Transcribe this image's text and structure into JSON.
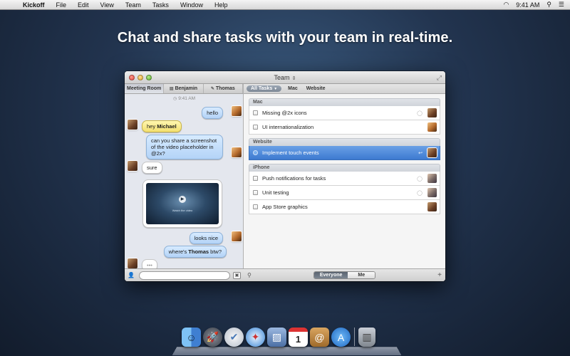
{
  "menubar": {
    "app_name": "Kickoff",
    "items": [
      "File",
      "Edit",
      "View",
      "Team",
      "Tasks",
      "Window",
      "Help"
    ],
    "time": "9:41 AM"
  },
  "headline": "Chat and share tasks with your team in real-time.",
  "window": {
    "title": "Team",
    "left_tabs": [
      "Meeting Room",
      "Benjamin",
      "Thomas"
    ],
    "chat": {
      "timestamp": "9:41 AM",
      "messages": [
        {
          "text": "hello"
        },
        {
          "prefix": "hey ",
          "bold": "Michael"
        },
        {
          "text": "can you share a screenshot of the video placeholder in @2x?"
        },
        {
          "text": "sure"
        },
        {
          "text": "looks nice"
        },
        {
          "prefix": "where's ",
          "bold": "Thomas",
          "suffix": " btw?"
        },
        {
          "text": "•••"
        }
      ],
      "video_caption": "Watch the video"
    },
    "message_input": {
      "value": "",
      "placeholder": ""
    },
    "filters": {
      "selected": "All Tasks",
      "items": [
        "Mac",
        "Website"
      ]
    },
    "task_groups": [
      {
        "name": "Mac",
        "tasks": [
          {
            "label": "Missing @2x icons",
            "comment": true,
            "assignee": "benjamin"
          },
          {
            "label": "UI internationalization",
            "comment": false,
            "assignee": "michael"
          }
        ]
      },
      {
        "name": "Website",
        "tasks": [
          {
            "label": "Implement touch events",
            "comment": true,
            "assignee": "benjamin",
            "selected": true
          }
        ]
      },
      {
        "name": "iPhone",
        "tasks": [
          {
            "label": "Push notifications for tasks",
            "comment": true,
            "assignee": "thomas"
          },
          {
            "label": "Unit testing",
            "comment": true,
            "assignee": "thomas"
          },
          {
            "label": "App Store graphics",
            "comment": false,
            "assignee": "benjamin"
          }
        ]
      }
    ],
    "segment": {
      "everyone": "Everyone",
      "me": "Me",
      "selected": "Everyone"
    }
  },
  "dock": {
    "icons": [
      "finder-icon",
      "launchpad-icon",
      "kickoff-icon",
      "safari-icon",
      "preview-icon",
      "calendar-icon",
      "contacts-icon",
      "app-store-icon",
      "trash-icon"
    ],
    "calendar_day": "1"
  }
}
